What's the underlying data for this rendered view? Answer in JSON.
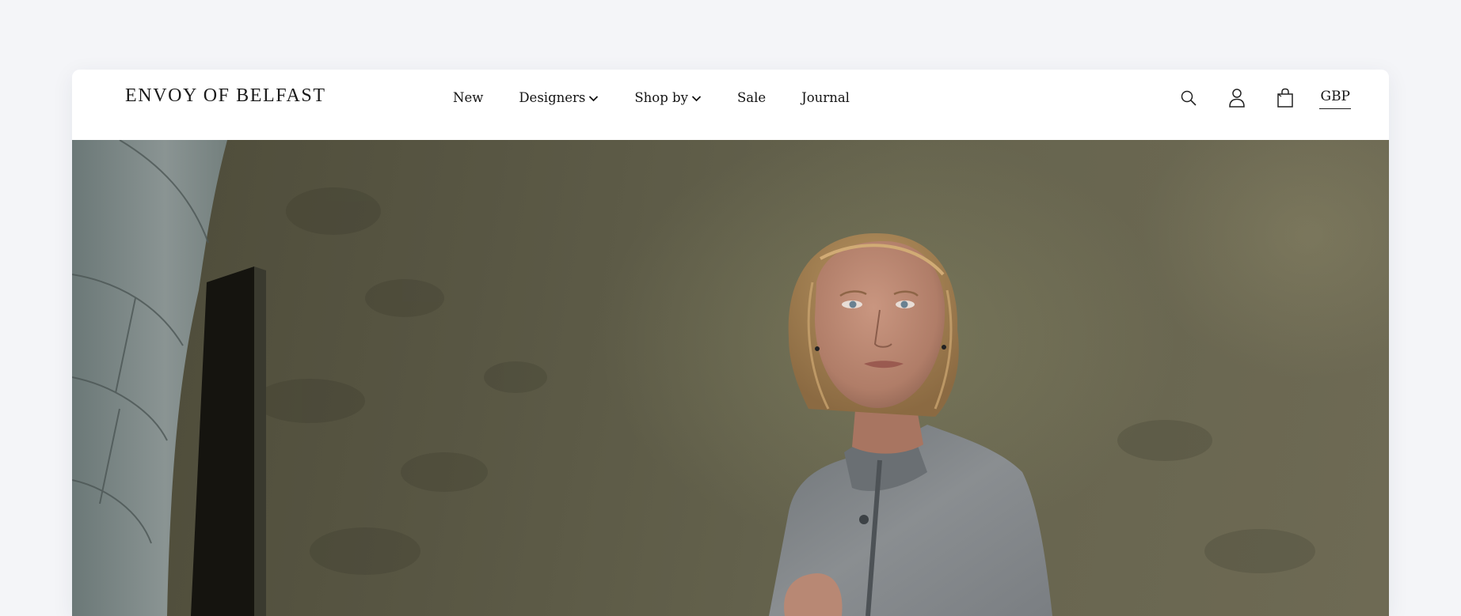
{
  "brand": {
    "logo_text": "ENVOY OF BELFAST"
  },
  "nav": {
    "items": [
      {
        "label": "New",
        "has_dropdown": false
      },
      {
        "label": "Designers",
        "has_dropdown": true
      },
      {
        "label": "Shop by",
        "has_dropdown": true
      },
      {
        "label": "Sale",
        "has_dropdown": false
      },
      {
        "label": "Journal",
        "has_dropdown": false
      }
    ]
  },
  "tools": {
    "icons": [
      "search-icon",
      "account-icon",
      "shopping-bag-icon"
    ],
    "currency": "GBP"
  },
  "hero": {
    "image": "editorial-model-grey-jacket-stone-wall"
  },
  "colors": {
    "page_background": "#f4f5f8",
    "header_background": "#ffffff",
    "text": "#141414"
  }
}
